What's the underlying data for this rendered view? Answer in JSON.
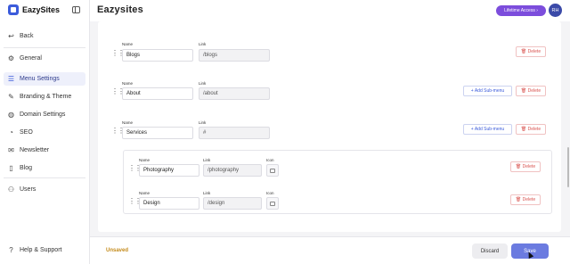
{
  "app": {
    "name": "EazySites",
    "title": "Eazysites"
  },
  "header": {
    "badge": "Lifetime Access ›",
    "avatar_initials": "RH"
  },
  "sidebar": {
    "back": "Back",
    "items": [
      {
        "label": "General",
        "icon": "gear-icon"
      },
      {
        "label": "Menu Settings",
        "icon": "menu-icon"
      },
      {
        "label": "Branding & Theme",
        "icon": "brush-icon"
      },
      {
        "label": "Domain Settings",
        "icon": "globe-icon"
      },
      {
        "label": "SEO",
        "icon": "seo-icon"
      },
      {
        "label": "Newsletter",
        "icon": "newsletter-icon"
      },
      {
        "label": "Blog",
        "icon": "book-icon"
      },
      {
        "label": "Users",
        "icon": "users-icon"
      }
    ],
    "help": "Help & Support"
  },
  "menu": {
    "labels": {
      "name": "Name",
      "link": "Link",
      "icon": "Icon"
    },
    "delete_label": "Delete",
    "add_sub_label": "+ Add Sub-menu",
    "items": [
      {
        "name": "Blogs",
        "link": "/blogs"
      },
      {
        "name": "About",
        "link": "/about"
      },
      {
        "name": "Services",
        "link": "#"
      }
    ],
    "sub_items": [
      {
        "name": "Photography",
        "link": "/photography"
      },
      {
        "name": "Design",
        "link": "/design"
      }
    ]
  },
  "footer": {
    "status": "Unsaved",
    "discard": "Discard",
    "save": "Save"
  },
  "colors": {
    "accent": "#3b5bdb",
    "lifetime_badge": "#7c4ddc",
    "save_button": "#6b7be0",
    "delete": "#d9534f"
  }
}
